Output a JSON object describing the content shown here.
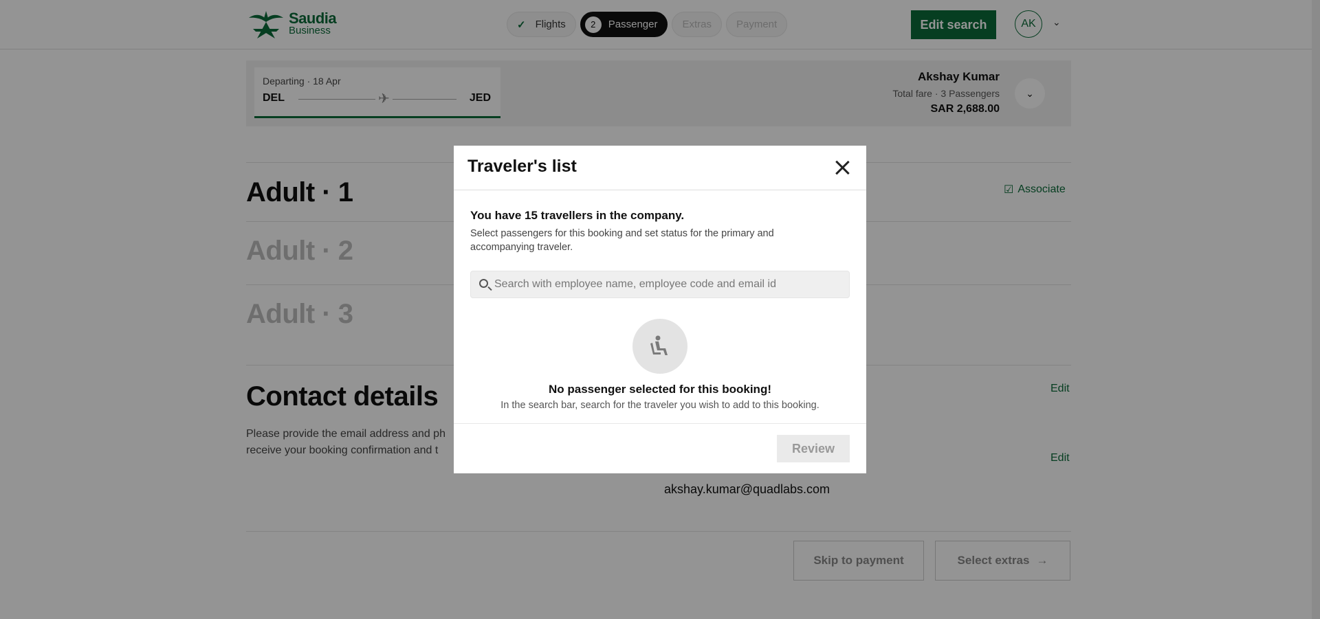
{
  "header": {
    "logo_line1": "Saudia",
    "logo_line2": "Business",
    "steps": [
      {
        "label": "Flights",
        "state": "done"
      },
      {
        "label": "Passenger",
        "state": "active",
        "number": "2"
      },
      {
        "label": "Extras",
        "state": "upcoming"
      },
      {
        "label": "Payment",
        "state": "upcoming"
      }
    ],
    "edit_search_label": "Edit search",
    "avatar_initials": "AK"
  },
  "summary": {
    "departing_label": "Departing · 18 Apr",
    "from": "DEL",
    "to": "JED",
    "traveler_name": "Akshay Kumar",
    "fare_label": "Total fare · 3 Passengers",
    "total": "SAR 2,688.00"
  },
  "passengers": [
    {
      "label": "Adult · 1"
    },
    {
      "label": "Adult · 2"
    },
    {
      "label": "Adult · 3"
    }
  ],
  "associate_label": "Associate",
  "contact": {
    "title": "Contact details",
    "description_line1": "Please provide the email address and ph",
    "description_line2": "receive your booking confirmation and t",
    "edit_label": "Edit",
    "email": "akshay.kumar@quadlabs.com"
  },
  "footer_buttons": {
    "skip_label": "Skip to payment",
    "next_label": "Select extras"
  },
  "modal": {
    "title": "Traveler's list",
    "count_text": "You have 15 travellers in the company.",
    "description": "Select passengers for this booking and set status for the primary and accompanying traveler.",
    "search_placeholder": "Search with employee name, employee code and email id",
    "empty_title": "No passenger selected for this booking!",
    "empty_subtitle": "In the search bar, search for the traveler you wish to add to this booking.",
    "review_label": "Review"
  },
  "colors": {
    "brand": "#0c6b39",
    "overlay": "rgba(0,0,0,0.42)"
  }
}
